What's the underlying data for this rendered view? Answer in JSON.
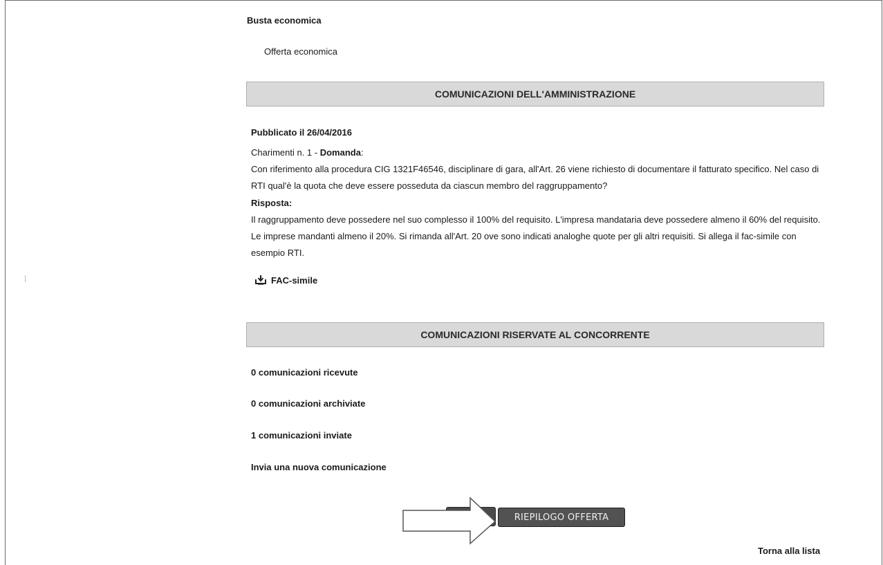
{
  "busta": {
    "title": "Busta economica",
    "item": "Offerta economica"
  },
  "communications_admin": {
    "header": "COMUNICAZIONI DELL'AMMINISTRAZIONE",
    "published": "Pubblicato il 26/04/2016",
    "question_prefix": "Charimenti n. 1 - ",
    "question_label": "Domanda",
    "question_suffix": ":",
    "question_text": "Con riferimento alla procedura CIG 1321F46546, disciplinare di gara, all'Art. 26 viene richiesto di documentare il fatturato specifico. Nel caso di RTI qual'è la quota che deve essere posseduta da ciascun membro del raggruppamento?",
    "answer_label": "Risposta:",
    "answer_text": "Il raggruppamento deve possedere nel suo complesso il 100% del requisito. L'impresa mandataria deve possedere almeno il 60% del requisito. Le imprese mandanti almeno il 20%. Si rimanda all'Art. 20 ove sono indicati analoghe quote per gli altri requisiti. Si allega il fac-simile con esempio RTI.",
    "attachment_label": "FAC-simile",
    "attachment_icon": "download-icon"
  },
  "communications_reserved": {
    "header": "COMUNICAZIONI RISERVATE AL CONCORRENTE",
    "received": "0 comunicazioni ricevute",
    "archived": "0 comunicazioni archiviate",
    "sent": "1 comunicazioni inviate",
    "new": "Invia una nuova comunicazione"
  },
  "actions": {
    "summary_button": "RIEPILOGO OFFERTA",
    "back_link": "Torna alla lista"
  },
  "colors": {
    "header_bg": "#d9d9d9",
    "button_bg": "#525252"
  }
}
